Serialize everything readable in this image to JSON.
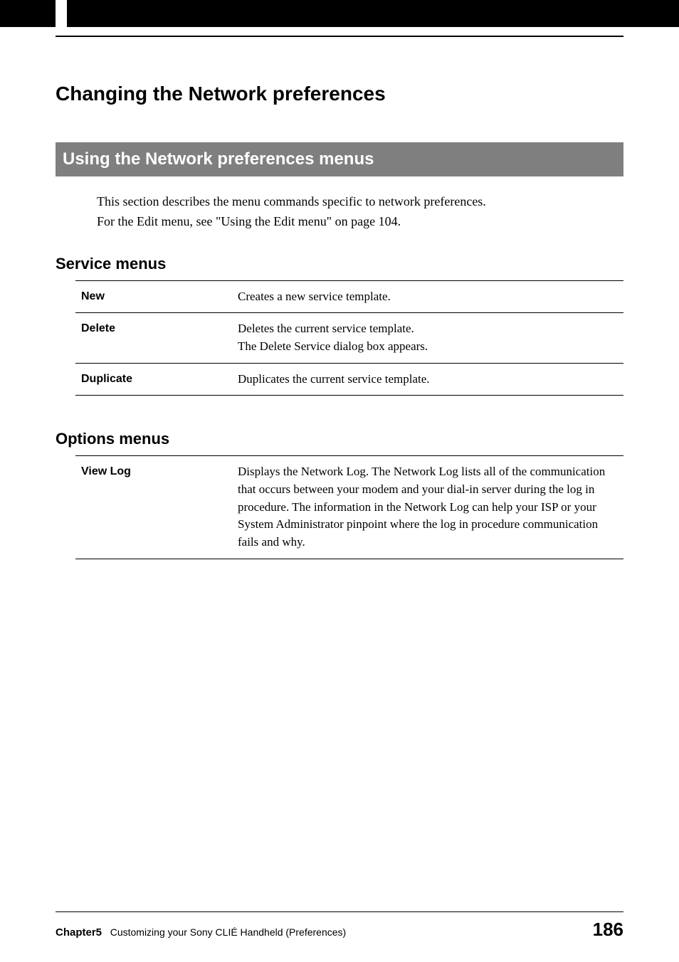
{
  "page_title": "Changing the Network preferences",
  "section_banner": "Using the Network preferences menus",
  "intro_line1": "This section describes the menu commands specific to network preferences.",
  "intro_line2": "For the Edit menu, see \"Using the Edit menu\" on page 104.",
  "service_menus_heading": "Service menus",
  "service_menus": [
    {
      "name": "New",
      "desc": "Creates a new service template."
    },
    {
      "name": "Delete",
      "desc": "Deletes the current service template.\nThe Delete Service dialog box appears."
    },
    {
      "name": "Duplicate",
      "desc": "Duplicates the current service template."
    }
  ],
  "options_menus_heading": "Options menus",
  "options_menus": [
    {
      "name": "View Log",
      "desc": "Displays the Network Log. The Network Log lists all of the communication that occurs between your modem and your dial-in server during the log in procedure. The information in the Network Log can help your ISP or your System Administrator pinpoint where the log in procedure communication fails and why."
    }
  ],
  "footer": {
    "chapter": "Chapter5",
    "chapter_title": "Customizing your Sony CLIÉ Handheld (Preferences)",
    "page_number": "186"
  }
}
